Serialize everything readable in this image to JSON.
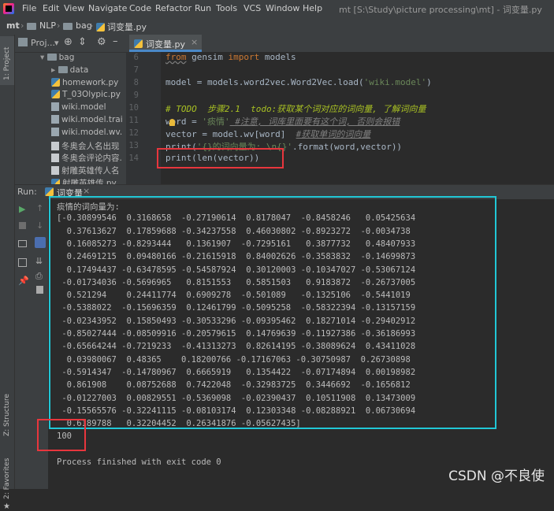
{
  "titlebar": {
    "menus": [
      "File",
      "Edit",
      "View",
      "Navigate",
      "Code",
      "Refactor",
      "Run",
      "Tools",
      "VCS",
      "Window",
      "Help"
    ],
    "window_title": "mt [S:\\Study\\picture processing\\mt] - 词变量.py"
  },
  "navbar": {
    "crumbs": [
      "mt",
      "NLP",
      "bag",
      "词变量.py"
    ]
  },
  "left_strip": {
    "project": "1: Project",
    "structure": "Z: Structure",
    "favorites": "2: Favorites"
  },
  "project_panel": {
    "header": "Proj...",
    "items": [
      {
        "label": "bag",
        "type": "folder",
        "indent": 1
      },
      {
        "label": "data",
        "type": "folder",
        "indent": 2
      },
      {
        "label": "homework.py",
        "type": "py",
        "indent": 2
      },
      {
        "label": "T_03Olypic.py",
        "type": "py",
        "indent": 2
      },
      {
        "label": "wiki.model",
        "type": "model",
        "indent": 2
      },
      {
        "label": "wiki.model.trai",
        "type": "model",
        "indent": 2
      },
      {
        "label": "wiki.model.wv.",
        "type": "model",
        "indent": 2
      },
      {
        "label": "冬奥会人名出现",
        "type": "txt",
        "indent": 2
      },
      {
        "label": "冬奥会评论内容.",
        "type": "txt",
        "indent": 2
      },
      {
        "label": "射雕英雄传人名",
        "type": "txt",
        "indent": 2
      },
      {
        "label": "射雕英雄传.py",
        "type": "py",
        "indent": 2
      }
    ]
  },
  "editor": {
    "tab": "词变量.py",
    "line_numbers": [
      "6",
      "7",
      "8",
      "9",
      "10",
      "11",
      "12",
      "13",
      "14"
    ],
    "lines": {
      "l6_from": "from",
      "l6_mod": " gensim ",
      "l6_import": "import",
      "l6_rest": " models",
      "l8_a": "model = models.word2vec.Word2Vec.load(",
      "l8_str": "'wiki.model'",
      "l8_b": ")",
      "l10_todo": "# TODO  步骤2.1  todo:获取某个词对应的词向量, 了解词向量",
      "l11_a": "word = ",
      "l11_str": "'痰情'",
      "l11_cm": " #注意, 词库里面要有这个词, 否则会报错",
      "l12_a": "vector = model.wv[word]  ",
      "l12_cm": "#获取单词的词向量",
      "l13_a": "print(",
      "l13_str": "'{}的词向量为: \\n{}'",
      "l13_b": ".format(word,vector))",
      "l14": "print(len(vector))"
    }
  },
  "run_panel": {
    "label": "Run:",
    "tab": "词变量",
    "output": [
      "痰情的词向量为:",
      "[-0.30899546  0.3168658  -0.27190614  0.8178047  -0.8458246   0.05425634",
      "  0.37613627  0.17859688 -0.34237558  0.46030802 -0.8923272  -0.0034738",
      "  0.16085273 -0.8293444   0.1361907  -0.7295161   0.3877732   0.48407933",
      "  0.24691215  0.09480166 -0.21615918  0.84002626 -0.3583832  -0.14699873",
      "  0.17494437 -0.63478595 -0.54587924  0.30120003 -0.10347027 -0.53067124",
      " -0.01734036 -0.5696965   0.8151553   0.5851503   0.9183872  -0.26737005",
      "  0.521294    0.24411774  0.6909278  -0.501089   -0.1325106  -0.5441019",
      " -0.5388022  -0.15696359  0.12461799 -0.5095258  -0.58322394 -0.13157159",
      " -0.02343952  0.15850493 -0.30533296 -0.09395462  0.18271014 -0.29402912",
      " -0.85027444 -0.08509916 -0.20579615  0.14769639 -0.11927386 -0.36186993",
      " -0.65664244 -0.7219233  -0.41313273  0.82614195 -0.38089624  0.43411028",
      "  0.03980067  0.48365    0.18200766 -0.17167063 -0.30750987  0.26730898",
      " -0.5914347  -0.14780967  0.6665919   0.1354422  -0.07174894  0.00198982",
      "  0.861908    0.08752688  0.7422048  -0.32983725  0.3446692  -0.1656812",
      " -0.01227003  0.00829551 -0.5369098  -0.02390437  0.10511908  0.13473009",
      " -0.15565576 -0.32241115 -0.08103174  0.12303348 -0.08288921  0.06730694",
      "  0.6189788   0.32204452  0.26341876 -0.05627435]",
      "100",
      "",
      "Process finished with exit code 0"
    ]
  },
  "watermark": "CSDN @不良使"
}
